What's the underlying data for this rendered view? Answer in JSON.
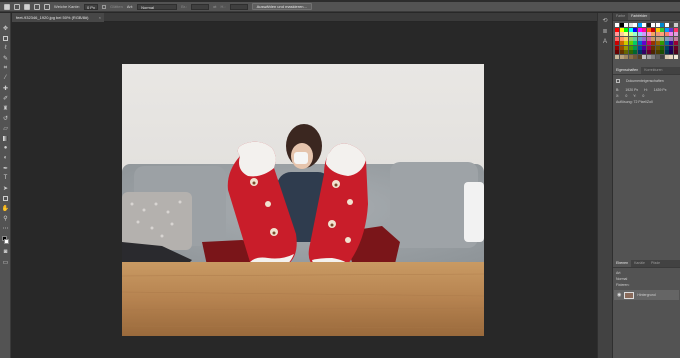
{
  "options_bar": {
    "weiche_kante_label": "Weiche Kante:",
    "weiche_kante_value": "0 Px",
    "glaetten_label": "Glätten",
    "art_label": "Art:",
    "art_value": "Normal",
    "breite_label": "Br.:",
    "hoehe_label": "H.:",
    "select_button": "Auswählen und maskieren..."
  },
  "document": {
    "tab_label": "feet-932346_1920.jpg bei 50% (RGB/8#)",
    "close_glyph": "×"
  },
  "swatches_panel": {
    "tabs": [
      "Farbe",
      "Farbfelder"
    ],
    "active_tab": 1,
    "colors": [
      "#ffffff",
      "#000000",
      "#ffffff",
      "#e0e0e0",
      "#ffffff",
      "#00a2ff",
      "#ffffff",
      "#1a1a1a",
      "#ffffff",
      "#ffffff",
      "#0088cc",
      "#ffffff",
      "#444444",
      "#cccccc",
      "#ff0000",
      "#ffff00",
      "#00ff00",
      "#00ffff",
      "#0000ff",
      "#ff00ff",
      "#ff0099",
      "#ff6600",
      "#cc0000",
      "#ffcc00",
      "#33cc33",
      "#0099ff",
      "#6633cc",
      "#ff3366",
      "#ff9999",
      "#ffcc99",
      "#ffff99",
      "#ccff99",
      "#99ffcc",
      "#99ccff",
      "#cc99ff",
      "#ff99cc",
      "#f4a460",
      "#e9967a",
      "#ffa07a",
      "#fa8072",
      "#ee82ee",
      "#dda0dd",
      "#ff6666",
      "#ff9966",
      "#ffcc66",
      "#99cc66",
      "#66cc99",
      "#6699cc",
      "#9966cc",
      "#cc6699",
      "#cc9966",
      "#c0a080",
      "#a0c080",
      "#80a0c0",
      "#a080c0",
      "#c080a0",
      "#cc0000",
      "#cc6600",
      "#cccc00",
      "#66cc00",
      "#00cc66",
      "#0066cc",
      "#6600cc",
      "#cc0066",
      "#993300",
      "#996600",
      "#339900",
      "#006699",
      "#330099",
      "#990033",
      "#990000",
      "#994c00",
      "#999900",
      "#4c9900",
      "#00994c",
      "#004c99",
      "#4c0099",
      "#99004c",
      "#663300",
      "#665500",
      "#226600",
      "#004466",
      "#220066",
      "#660022",
      "#660000",
      "#663300",
      "#666600",
      "#336600",
      "#006633",
      "#003366",
      "#330066",
      "#660033",
      "#4d2600",
      "#4d3d00",
      "#1a4d00",
      "#00334d",
      "#1a004d",
      "#4d001a",
      "#c8b89a",
      "#b8a07a",
      "#a08860",
      "#8a6e48",
      "#705838",
      "#584228",
      "#c0c0c0",
      "#a0a0a0",
      "#808080",
      "#606060",
      "#404040",
      "#d8c8b0",
      "#e8d8c0",
      "#f0e8d8"
    ]
  },
  "properties_panel": {
    "tabs": [
      "Eigenschaften",
      "Korrekturen"
    ],
    "title": "Dokumenteigenschaften",
    "b_label": "B:",
    "b_value": "1920 Px",
    "h_label": "H:",
    "h_value": "1439 Px",
    "x_label": "X:",
    "x_value": "0",
    "y_label": "Y:",
    "y_value": "0",
    "resolution": "Auflösung: 72 Pixel/Zoll"
  },
  "layers_panel": {
    "tabs": [
      "Ebenen",
      "Kanäle",
      "Pfade"
    ],
    "kind_label": "Art",
    "blend_mode": "Normal",
    "lock_label": "Fixieren:",
    "layer_name": "Hintergrund"
  }
}
